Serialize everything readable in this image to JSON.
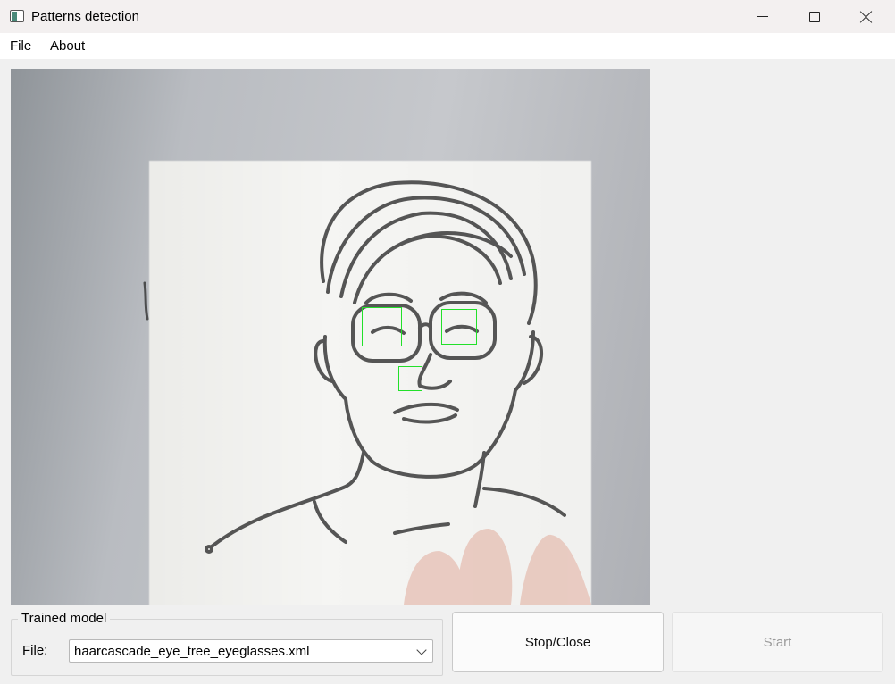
{
  "window": {
    "title": "Patterns detection"
  },
  "menu": {
    "items": [
      "File",
      "About"
    ]
  },
  "detection": {
    "box_count": 3,
    "box_color": "#22e02a"
  },
  "trained_model": {
    "group_title": "Trained model",
    "file_label": "File:",
    "selected_file": "haarcascade_eye_tree_eyeglasses.xml"
  },
  "buttons": {
    "stop_close": "Stop/Close",
    "start": "Start"
  },
  "icons": {
    "app": "app-window-icon",
    "minimize": "minimize-icon",
    "maximize": "maximize-icon",
    "close": "close-icon",
    "dropdown": "chevron-down-icon"
  }
}
